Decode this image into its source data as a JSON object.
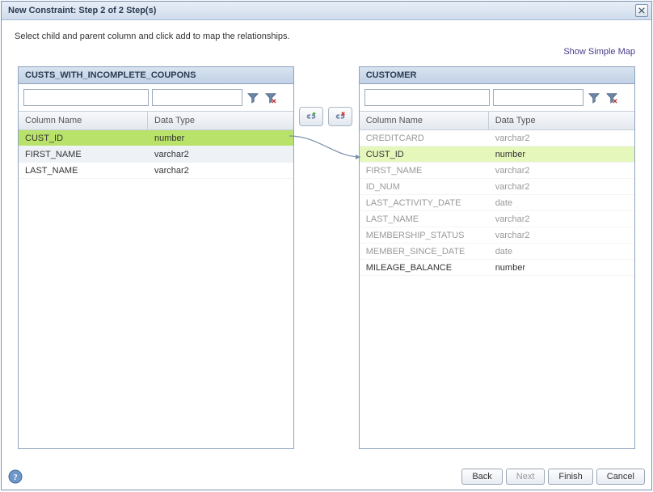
{
  "dialog": {
    "title": "New Constraint: Step 2 of 2 Step(s)"
  },
  "instruction": "Select child and parent column and click add to map the relationships.",
  "link_simple": "Show Simple Map",
  "left_panel": {
    "title": "CUSTS_WITH_INCOMPLETE_COUPONS",
    "filter1_placeholder": "",
    "filter2_placeholder": "",
    "col_header_a": "Column Name",
    "col_header_b": "Data Type",
    "rows": [
      {
        "name": "CUST_ID",
        "type": "number",
        "state": "selected"
      },
      {
        "name": "FIRST_NAME",
        "type": "varchar2",
        "state": "alt"
      },
      {
        "name": "LAST_NAME",
        "type": "varchar2",
        "state": ""
      }
    ]
  },
  "right_panel": {
    "title": "CUSTOMER",
    "filter1_placeholder": "",
    "filter2_placeholder": "",
    "col_header_a": "Column Name",
    "col_header_b": "Data Type",
    "rows": [
      {
        "name": "CREDITCARD",
        "type": "varchar2",
        "state": "muted"
      },
      {
        "name": "CUST_ID",
        "type": "number",
        "state": "selected-light"
      },
      {
        "name": "FIRST_NAME",
        "type": "varchar2",
        "state": "muted"
      },
      {
        "name": "ID_NUM",
        "type": "varchar2",
        "state": "muted"
      },
      {
        "name": "LAST_ACTIVITY_DATE",
        "type": "date",
        "state": "muted"
      },
      {
        "name": "LAST_NAME",
        "type": "varchar2",
        "state": "muted"
      },
      {
        "name": "MEMBERSHIP_STATUS",
        "type": "varchar2",
        "state": "muted"
      },
      {
        "name": "MEMBER_SINCE_DATE",
        "type": "date",
        "state": "muted"
      },
      {
        "name": "MILEAGE_BALANCE",
        "type": "number",
        "state": ""
      }
    ]
  },
  "buttons": {
    "back": "Back",
    "next": "Next",
    "finish": "Finish",
    "cancel": "Cancel"
  },
  "icons": {
    "close": "close-icon",
    "funnel": "funnel-icon",
    "funnel_clear": "funnel-clear-icon",
    "link_add": "link-add-icon",
    "link_remove": "link-remove-icon",
    "help": "help-icon"
  }
}
